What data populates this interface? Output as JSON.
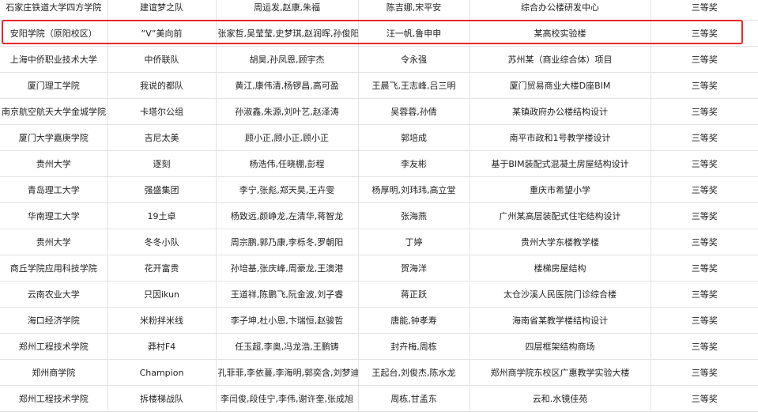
{
  "rows": [
    {
      "school": "石家庄铁道大学四方学院",
      "team": "建谊梦之队",
      "members": "周运发,赵康,朱福",
      "advisors": "陈吉娜,宋平安",
      "project": "综合办公楼研发中心",
      "award": "三等奖"
    },
    {
      "school": "安阳学院（原阳校区）",
      "team": "“V”美向前",
      "members": "张家哲,吴莹莹,史梦琪,赵润晖,孙俊阳",
      "advisors": "汪一帆,鲁申申",
      "project": "某高校实验楼",
      "award": "三等奖"
    },
    {
      "school": "上海中侨职业技术大学",
      "team": "中侨联队",
      "members": "胡昊,孙凤恩,顾宇杰",
      "advisors": "令永强",
      "project": "苏州某（商业综合体）项目",
      "award": "三等奖"
    },
    {
      "school": "厦门理工学院",
      "team": "我说的都队",
      "members": "黄江,康伟清,杨锣昌,高可盈",
      "advisors": "王晨飞,王志峰,吕三明",
      "project": "厦门贸易商业大楼D座BIM",
      "award": "三等奖"
    },
    {
      "school": "南京航空航天大学金城学院",
      "team": "卡塔尔公组",
      "members": "孙淑鑫,朱源,刘叶艺,赵泽涛",
      "advisors": "吴蓉蓉,孙倩",
      "project": "某镇政府办公楼结构设计",
      "award": "三等奖"
    },
    {
      "school": "厦门大学嘉庚学院",
      "team": "吉尼太美",
      "members": "顾小正,顾小正,顾小正",
      "advisors": "郭培成",
      "project": "南平市政和1号教学楼设计",
      "award": "三等奖"
    },
    {
      "school": "贵州大学",
      "team": "逐刻",
      "members": "杨浩伟,任晓棚,彭程",
      "advisors": "李友彬",
      "project": "基于BIM装配式混凝土房屋结构设计",
      "award": "三等奖"
    },
    {
      "school": "青岛理工大学",
      "team": "强盛集团",
      "members": "李宁,张彪,郑天昊,王卉雯",
      "advisors": "杨厚明,刘玮玮,高立堂",
      "project": "重庆市希望小学",
      "award": "三等奖"
    },
    {
      "school": "华南理工大学",
      "team": "19土卓",
      "members": "杨致远,颜峥龙,左清华,蒋智龙",
      "advisors": "张海燕",
      "project": "广州某高层装配式住宅结构设计",
      "award": "三等奖"
    },
    {
      "school": "贵州大学",
      "team": "冬冬小队",
      "members": "周宗鹏,郭乃康,李栎冬,罗朝阳",
      "advisors": "丁婷",
      "project": "贵州大学东楼教学楼",
      "award": "三等奖"
    },
    {
      "school": "商丘学院应用科技学院",
      "team": "花开富贵",
      "members": "孙培基,张庆峰,周豪龙,王澳港",
      "advisors": "贺海洋",
      "project": "楼梯房屋结构",
      "award": "三等奖"
    },
    {
      "school": "云南农业大学",
      "team": "只因ikun",
      "members": "王道祥,陈鹏飞,阮金波,刘子睿",
      "advisors": "蒋正跃",
      "project": "太仓沙溪人民医院门诊综合楼",
      "award": "三等奖"
    },
    {
      "school": "海口经济学院",
      "team": "米粉拌米线",
      "members": "李子坤,杜小恩,卞瑞恒,赵骏哲",
      "advisors": "唐能,钟孝寿",
      "project": "海南省某教学楼结构设计",
      "award": "三等奖"
    },
    {
      "school": "郑州工程技术学院",
      "team": "莽村F4",
      "members": "任玉超,李奥,冯龙浩,王鹏铸",
      "advisors": "封卉梅,周栋",
      "project": "四层框架结构商场",
      "award": "三等奖"
    },
    {
      "school": "郑州商学院",
      "team": "Champion",
      "members": "孔菲菲,李依蔓,李海明,郭奕含,刘梦迪",
      "advisors": "王起台,刘俊杰,陈水龙",
      "project": "郑州商学院东校区广惠教学实验大楼",
      "award": "三等奖"
    },
    {
      "school": "郑州工程技术学院",
      "team": "拆楼梯战队",
      "members": "李闫俊,段佳宁,李伟,谢许奎,张成旭",
      "advisors": "周栋,甘孟东",
      "project": "云和.水镜佳苑",
      "award": "三等奖"
    }
  ]
}
